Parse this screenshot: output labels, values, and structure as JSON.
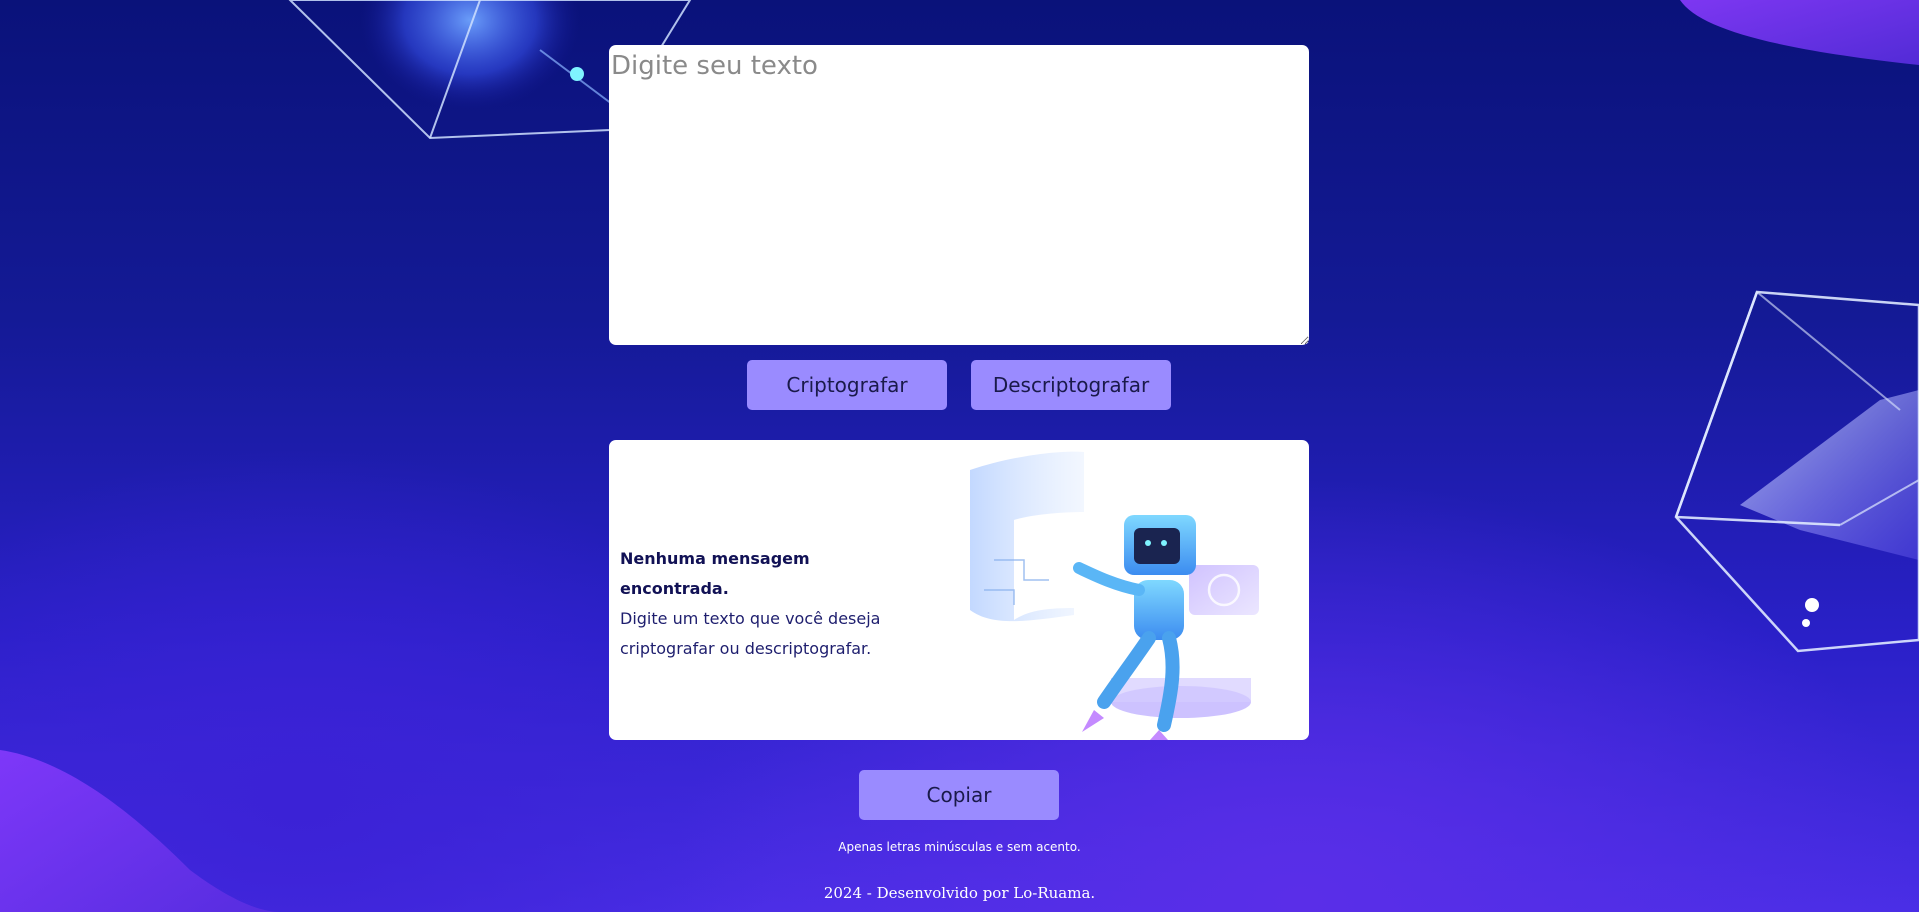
{
  "input": {
    "placeholder": "Digite seu texto",
    "value": ""
  },
  "actions": {
    "encrypt_label": "Criptografar",
    "decrypt_label": "Descriptografar",
    "copy_label": "Copiar"
  },
  "output": {
    "title": "Nenhuma mensagem encontrada.",
    "line1": "Digite um texto que você deseja",
    "line2": "criptografar ou descriptografar."
  },
  "hint": "Apenas letras minúsculas e sem acento.",
  "footer": "2024 - Desenvolvido por Lo-Ruama.",
  "colors": {
    "background_top": "#0a127a",
    "background_bottom": "#4a2ee6",
    "button": "#9a8bff",
    "card": "#ffffff",
    "text_dark": "#1e1e6e"
  },
  "icons": {
    "illustration": "robot-illustration"
  }
}
